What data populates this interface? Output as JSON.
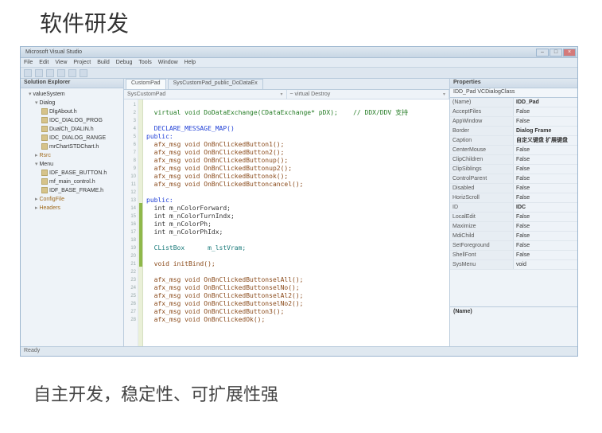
{
  "page": {
    "title": "软件研发",
    "caption": "自主开发，稳定性、可扩展性强"
  },
  "window": {
    "title": "Microsoft Visual Studio"
  },
  "menubar": [
    "File",
    "Edit",
    "View",
    "Project",
    "Build",
    "Debug",
    "Tools",
    "Window",
    "Help"
  ],
  "solution": {
    "header": "Solution Explorer",
    "root": "valueSystem",
    "nodes": [
      {
        "depth": 1,
        "type": "folder",
        "open": true,
        "label": "valueSystem"
      },
      {
        "depth": 2,
        "type": "folder",
        "open": true,
        "label": "Dialog"
      },
      {
        "depth": 3,
        "type": "file",
        "label": "DlgAbout.h"
      },
      {
        "depth": 3,
        "type": "file",
        "label": "IDC_DIALOG_PROG"
      },
      {
        "depth": 3,
        "type": "file",
        "label": "DualCh_DIALIN.h"
      },
      {
        "depth": 3,
        "type": "file",
        "label": "IDC_DIALOG_RANGE"
      },
      {
        "depth": 3,
        "type": "file",
        "label": "mrChartSTDChart.h"
      },
      {
        "depth": 2,
        "type": "folder",
        "open": false,
        "label": "Rsrc",
        "orange": true
      },
      {
        "depth": 2,
        "type": "folder",
        "open": true,
        "label": "Menu"
      },
      {
        "depth": 3,
        "type": "file",
        "label": "IDF_BASE_BUTTON.h"
      },
      {
        "depth": 3,
        "type": "file",
        "label": "mf_main_control.h"
      },
      {
        "depth": 3,
        "type": "file",
        "label": "IDF_BASE_FRAME.h"
      },
      {
        "depth": 2,
        "type": "folder",
        "open": false,
        "label": "ConfigFile",
        "orange": true
      },
      {
        "depth": 2,
        "type": "folder",
        "open": false,
        "label": "Headers",
        "orange": true
      }
    ]
  },
  "tabs": {
    "active": "CustomPad",
    "path": "SysCustomPad_public_DoDataEx"
  },
  "combos": {
    "left": "SysCustomPad",
    "right": "~ virtual Destroy"
  },
  "code_lines": [
    {
      "n": 1,
      "t": ""
    },
    {
      "n": 2,
      "t": "  virtual void DoDataExchange(CDataExchange* pDX);    // DDX/DDV 支持",
      "cls": "com"
    },
    {
      "n": 3,
      "t": ""
    },
    {
      "n": 4,
      "t": "  DECLARE_MESSAGE_MAP()",
      "cls": "kw"
    },
    {
      "n": 5,
      "t": "public:",
      "cls": "kw"
    },
    {
      "n": 6,
      "t": "  afx_msg void OnBnClickedButton1();",
      "cls": "brn"
    },
    {
      "n": 7,
      "t": "  afx_msg void OnBnClickedButton2();",
      "cls": "brn"
    },
    {
      "n": 8,
      "t": "  afx_msg void OnBnClickedButtonup();",
      "cls": "brn"
    },
    {
      "n": 9,
      "t": "  afx_msg void OnBnClickedButtonup2();",
      "cls": "brn"
    },
    {
      "n": 10,
      "t": "  afx_msg void OnBnClickedButtonok();",
      "cls": "brn"
    },
    {
      "n": 11,
      "t": "  afx_msg void OnBnClickedButtoncancel();",
      "cls": "brn"
    },
    {
      "n": 12,
      "t": ""
    },
    {
      "n": 13,
      "t": "public:",
      "cls": "kw"
    },
    {
      "n": 14,
      "t": "  int m_nColorForward;"
    },
    {
      "n": 15,
      "t": "  int m_nColorTurnIndx;"
    },
    {
      "n": 16,
      "t": "  int m_nColorPh;"
    },
    {
      "n": 17,
      "t": "  int m_nColorPhIdx;"
    },
    {
      "n": 18,
      "t": ""
    },
    {
      "n": 19,
      "t": "  CListBox      m_lstVram;",
      "cls": "typ"
    },
    {
      "n": 20,
      "t": ""
    },
    {
      "n": 21,
      "t": "  void initBind();",
      "cls": "brn"
    },
    {
      "n": 22,
      "t": ""
    },
    {
      "n": 23,
      "t": "  afx_msg void OnBnClickedButtonselAll();",
      "cls": "brn"
    },
    {
      "n": 24,
      "t": "  afx_msg void OnBnClickedButtonselNo();",
      "cls": "brn"
    },
    {
      "n": 25,
      "t": "  afx_msg void OnBnClickedButtonselAl2();",
      "cls": "brn"
    },
    {
      "n": 26,
      "t": "  afx_msg void OnBnClickedButtonselNo2();",
      "cls": "brn"
    },
    {
      "n": 27,
      "t": "  afx_msg void OnBnClickedButton3();",
      "cls": "brn"
    },
    {
      "n": 28,
      "t": "  afx_msg void OnBnClickedOk();",
      "cls": "brn"
    }
  ],
  "properties": {
    "header": "Properties",
    "subject": "IDD_Pad  VCDialogClass",
    "rows": [
      {
        "k": "(Name)",
        "v": "IDD_Pad"
      },
      {
        "k": "AcceptFiles",
        "v": "False"
      },
      {
        "k": "AppWindow",
        "v": "False"
      },
      {
        "k": "Border",
        "v": "Dialog Frame"
      },
      {
        "k": "Caption",
        "v": "自定义键盘 扩展键盘"
      },
      {
        "k": "CenterMouse",
        "v": "False"
      },
      {
        "k": "ClipChildren",
        "v": "False"
      },
      {
        "k": "ClipSiblings",
        "v": "False"
      },
      {
        "k": "ControlParent",
        "v": "False"
      },
      {
        "k": "Disabled",
        "v": "False"
      },
      {
        "k": "HorizScroll",
        "v": "False"
      },
      {
        "k": "ID",
        "v": "IDC"
      },
      {
        "k": "LocalEdit",
        "v": "False"
      },
      {
        "k": "Maximize",
        "v": "False"
      },
      {
        "k": "MdiChild",
        "v": "False"
      },
      {
        "k": "SetForeground",
        "v": "False"
      },
      {
        "k": "ShellFont",
        "v": "False"
      },
      {
        "k": "SysMenu",
        "v": "void"
      }
    ],
    "desc_title": "(Name)",
    "desc_text": ""
  },
  "statusbar": "Ready"
}
